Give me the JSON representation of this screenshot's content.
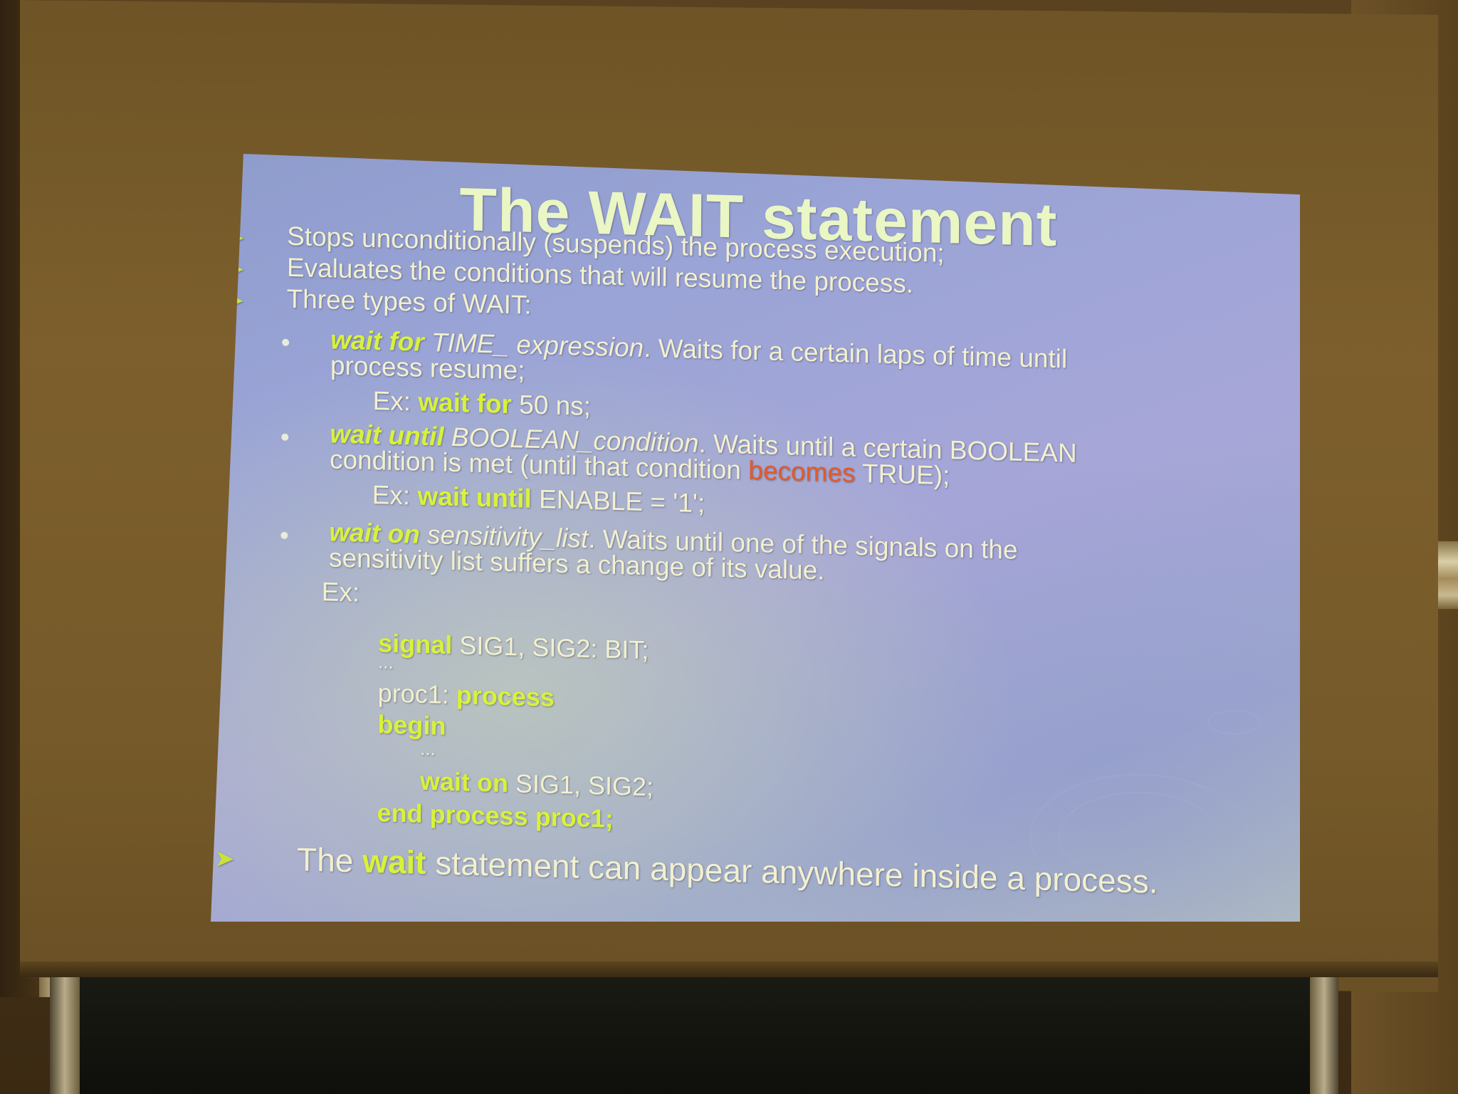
{
  "slide": {
    "title": "The WAIT statement",
    "bullets": [
      "Stops unconditionally (suspends) the process execution;",
      "Evaluates the conditions that will resume the process.",
      "Three types of WAIT:"
    ],
    "types": [
      {
        "keyword": "wait for",
        "param": "TIME_ expression",
        "desc_line1": ". Waits for a certain laps of time until",
        "desc_line2": "process resume;",
        "example_prefix": "Ex:",
        "example_keyword": "wait for",
        "example_rest": "50 ns;"
      },
      {
        "keyword": "wait until",
        "param": "BOOLEAN_condition",
        "desc_line1": ". Waits until a certain BOOLEAN",
        "desc_line2_a": "condition is met (until that condition",
        "desc_line2_highlight": "becomes",
        "desc_line2_b": "TRUE);",
        "example_prefix": "Ex:",
        "example_keyword": "wait until",
        "example_rest": "ENABLE = '1';"
      },
      {
        "keyword": "wait on",
        "param": "sensitivity_list",
        "desc_line1": ". Waits until one of the signals on the",
        "desc_line2": "sensitivity list suffers a change of its value.",
        "example_prefix": "Ex:"
      }
    ],
    "code": {
      "signal_kw": "signal",
      "signal_rest": "SIG1, SIG2: BIT;",
      "ellipsis": "...",
      "proc_label": "proc1:",
      "process_kw": "process",
      "begin_kw": "begin",
      "wait_on_kw": "wait on",
      "wait_on_rest": "SIG1, SIG2;",
      "end_kw": "end process",
      "end_rest": "proc1;"
    },
    "footer": {
      "prefix": "The",
      "keyword": "wait",
      "rest": "statement can appear anywhere inside a process."
    }
  }
}
